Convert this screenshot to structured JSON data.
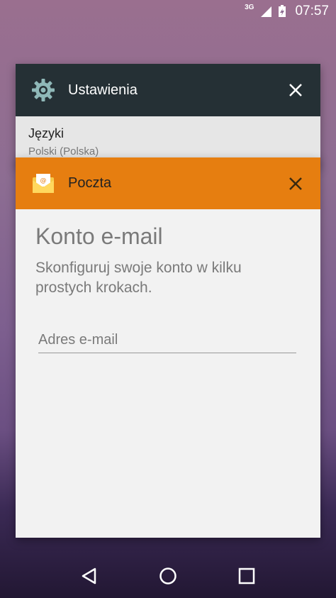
{
  "status_bar": {
    "network": "3G",
    "time": "07:57"
  },
  "recent_apps": [
    {
      "app_name": "Ustawienia",
      "icon": "gear-icon",
      "header_color": "#253035",
      "preview": {
        "item_title": "Języki",
        "item_subtitle": "Polski (Polska)"
      }
    },
    {
      "app_name": "Poczta",
      "icon": "mail-envelope-icon",
      "header_color": "#e67e10",
      "content": {
        "title": "Konto e-mail",
        "description": "Skonfiguruj swoje konto w kilku prostych krokach.",
        "email_placeholder": "Adres e-mail"
      }
    }
  ],
  "nav_bar": {
    "back": "back-icon",
    "home": "home-icon",
    "recents": "recents-icon"
  }
}
